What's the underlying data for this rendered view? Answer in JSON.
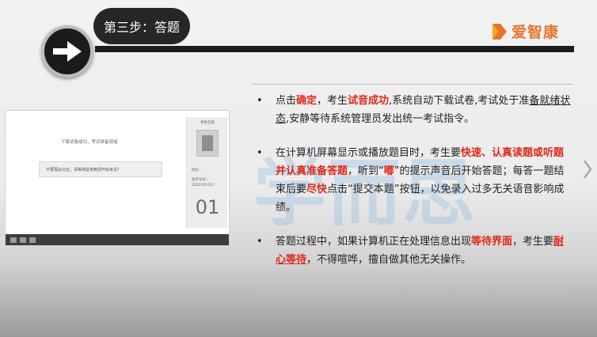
{
  "header": {
    "step_title": "第三步：答题",
    "brand_name": "爱智康",
    "brand_color": "#e8742b"
  },
  "watermark": {
    "text": "学而思"
  },
  "thumbnail": {
    "status_text": "下载试卷成功，考试准备就绪",
    "notice_text": "不要再此点击，请等待监考教师开始考试！",
    "side_title": "考生信息",
    "info_line1": "姓名：",
    "info_line2": "准考证号：",
    "info_line3": "2022101011",
    "seat_number": "01"
  },
  "bullets": [
    {
      "segments": [
        {
          "text": "点击"
        },
        {
          "text": "确定",
          "style": "red"
        },
        {
          "text": "，考生"
        },
        {
          "text": "试音成功",
          "style": "red"
        },
        {
          "text": ",系统自动下载试卷,考试处于准"
        },
        {
          "text": "备就绪状态",
          "style": "ul"
        },
        {
          "text": ",安静等待系统管理员发出统一考试指令。"
        }
      ]
    },
    {
      "segments": [
        {
          "text": "在计算机屏幕显示或播放题目时，考生要"
        },
        {
          "text": "快速、认真读题或听题并认真准备答题",
          "style": "red"
        },
        {
          "text": "，听到“"
        },
        {
          "text": "嘟",
          "style": "red"
        },
        {
          "text": "”的提示声音后开始答题；每答一题结束后要"
        },
        {
          "text": "尽快",
          "style": "red"
        },
        {
          "text": "点击“提交本题”按钮，以免录入过多无关语音影响成绩。"
        }
      ]
    },
    {
      "segments": [
        {
          "text": "答题过程中，如果计算机正在处理信息出现"
        },
        {
          "text": "等待界面",
          "style": "red"
        },
        {
          "text": "，考生要"
        },
        {
          "text": "耐心等待",
          "style": "red-ul"
        },
        {
          "text": "，不得喧哗，擅自做其他无关操作。"
        }
      ]
    }
  ],
  "icons": {
    "arrow": "arrow-right-icon",
    "logo": "logo-icon",
    "next": "chevron-right-icon"
  },
  "colors": {
    "accent_red": "#e0281a",
    "header_dark": "#1d1d1d"
  }
}
